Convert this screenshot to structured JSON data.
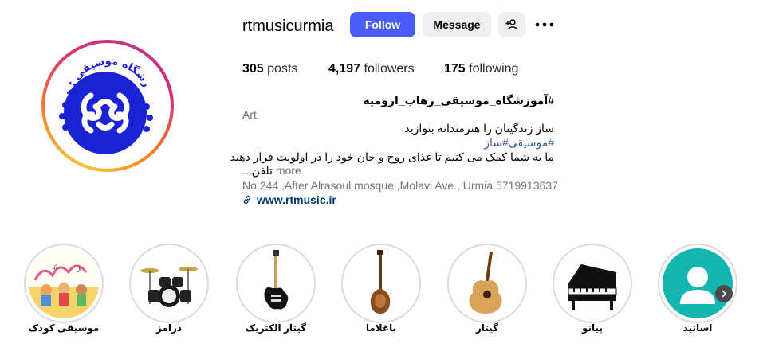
{
  "profile": {
    "username": "rtmusicurmia",
    "follow_label": "Follow",
    "message_label": "Message",
    "logo_text": "آموزشگاه موسیقی رُهاب"
  },
  "stats": {
    "posts_count": "305",
    "posts_label": "posts",
    "followers_count": "4,197",
    "followers_label": "followers",
    "following_count": "175",
    "following_label": "following"
  },
  "bio": {
    "title": "#آموزشگاه_موسیقی_رهاب_ارومیه",
    "category": "Art",
    "line1": "ساز زندگیتان را هنرمندانه بنوازید",
    "hashtags": "#موسیقی#ساز",
    "line3": "ما به شما کمک می کنیم تا غذای روح و جان خود را در اولویت قرار دهید",
    "line4": "تلفن...",
    "more_label": "more",
    "address": "No 244 ,After Alrasoul mosque ,Molavi Ave., Urmia 5719913637",
    "link": "www.rtmusic.ir"
  },
  "highlights": [
    {
      "label": "موسیقی کودک"
    },
    {
      "label": "درامز"
    },
    {
      "label": "گیتار الکتریک"
    },
    {
      "label": "باغلاما"
    },
    {
      "label": "گیتار"
    },
    {
      "label": "پیانو"
    },
    {
      "label": "اساتید"
    }
  ],
  "colors": {
    "follow_button": "#4a5df9",
    "logo_blue": "#1a22d4",
    "teal": "#15b5b0"
  }
}
